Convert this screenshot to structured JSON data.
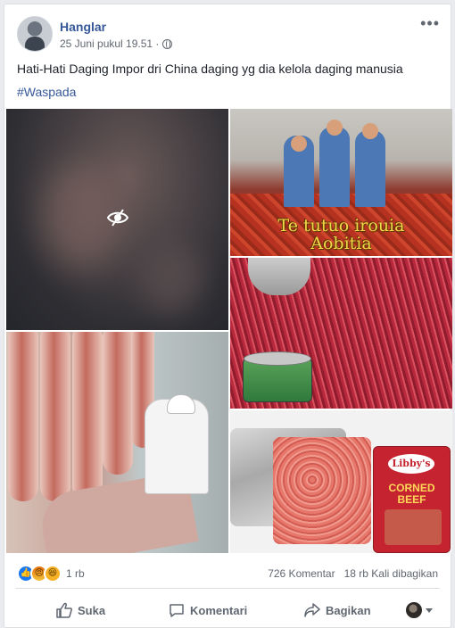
{
  "post": {
    "author": "Hanglar",
    "timestamp": "25 Juni pukul 19.51 ·",
    "more_label": "•••",
    "text": "Hati-Hati Daging Impor dri China daging yg dia kelola daging manusia",
    "hashtag": "#Waspada"
  },
  "photos": {
    "sensitive_icon": "eye-slash-icon",
    "police_caption_line1": "Te tutuo irouia",
    "police_caption_line2": "Aobitia",
    "libby_brand": "Libby's",
    "libby_product": "CORNED BEEF"
  },
  "reactions": {
    "types": [
      "like",
      "angry",
      "haha"
    ],
    "count": "1 rb",
    "comments": "726 Komentar",
    "shares": "18 rb Kali dibagikan"
  },
  "actions": {
    "like": "Suka",
    "comment": "Komentari",
    "share": "Bagikan"
  },
  "colors": {
    "link": "#365899",
    "meta": "#616770",
    "background": "#e9ebee"
  }
}
